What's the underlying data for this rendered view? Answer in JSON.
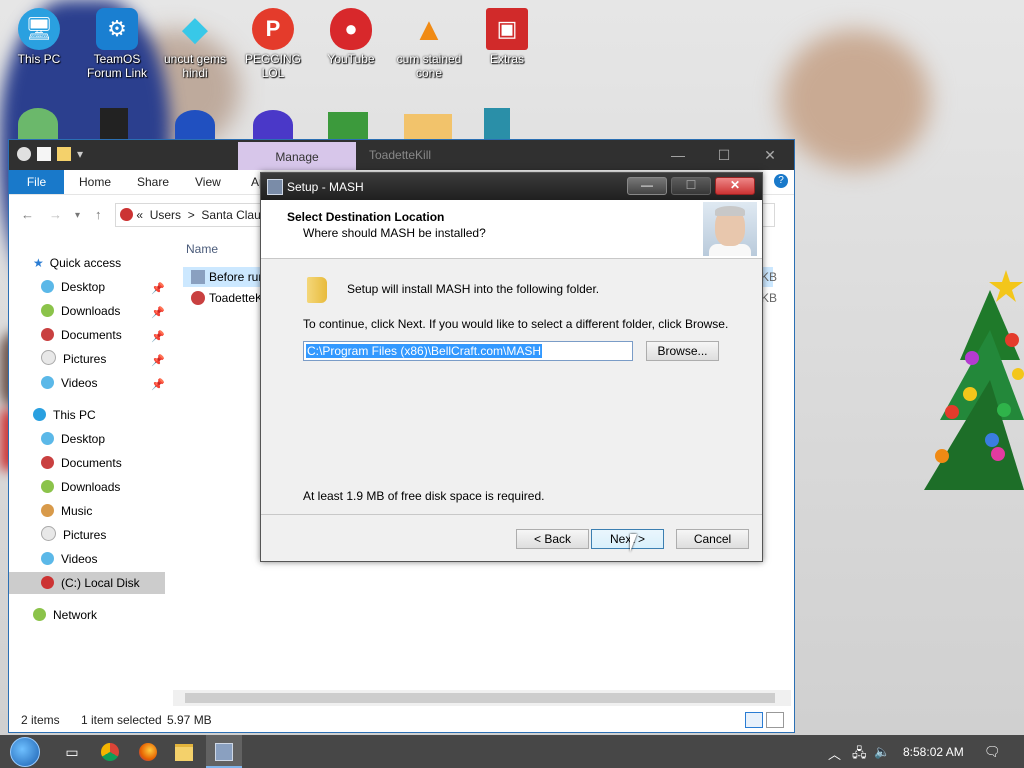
{
  "desktop": {
    "icons": [
      {
        "label": "This PC",
        "icon": "monitor-icon",
        "color": "#2aa0e0"
      },
      {
        "label": "TeamOS Forum Link",
        "icon": "gear-icon",
        "color": "#1a7fd1"
      },
      {
        "label": "uncut gems hindi",
        "icon": "diamond-icon",
        "color": "#38c8e8"
      },
      {
        "label": "PEGGING LOL",
        "icon": "peggle-icon",
        "color": "#e43b2b"
      },
      {
        "label": "YouTube",
        "icon": "angry-bird-icon",
        "color": "#d8282b"
      },
      {
        "label": "cum stained cone",
        "icon": "vlc-cone-icon",
        "color": "#f08a14"
      },
      {
        "label": "Extras",
        "icon": "gift-box-icon",
        "color": "#d12a2a"
      }
    ]
  },
  "explorer": {
    "manage_tab": "Manage",
    "window_name": "ToadetteKill",
    "ribbon": {
      "file": "File",
      "home": "Home",
      "share": "Share",
      "view": "View",
      "app": "Ap"
    },
    "address": {
      "prefix": "«",
      "crumb1": "Users",
      "sep": ">",
      "crumb2": "Santa Clau"
    },
    "column_name": "Name",
    "nav": {
      "quick_access": "Quick access",
      "qa_items": [
        "Desktop",
        "Downloads",
        "Documents",
        "Pictures",
        "Videos"
      ],
      "this_pc": "This PC",
      "pc_items": [
        "Desktop",
        "Documents",
        "Downloads",
        "Music",
        "Pictures",
        "Videos"
      ],
      "local_disk": "(C:) Local Disk",
      "network": "Network"
    },
    "files": [
      {
        "name": "Before run",
        "size": "KB"
      },
      {
        "name": "ToadetteKi",
        "size": "KB"
      }
    ],
    "status": {
      "items": "2 items",
      "selected": "1 item selected",
      "size": "5.97 MB"
    }
  },
  "setup": {
    "title": "Setup - MASH",
    "heading": "Select Destination Location",
    "subheading": "Where should MASH be installed?",
    "install_text": "Setup will install MASH into the following folder.",
    "continue_text": "To continue, click Next. If you would like to select a different folder, click Browse.",
    "path_value": "C:\\Program Files (x86)\\BellCraft.com\\MASH",
    "browse_label": "Browse...",
    "disk_space_text": "At least 1.9 MB of free disk space is required.",
    "back_label": "< Back",
    "next_label": "Next >",
    "cancel_label": "Cancel"
  },
  "taskbar": {
    "clock": "8:58:02 AM"
  }
}
